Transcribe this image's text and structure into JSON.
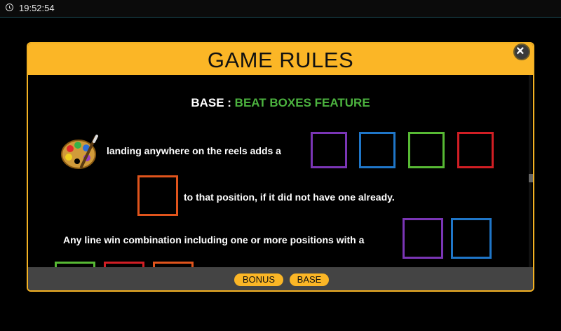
{
  "status_bar": {
    "time": "19:52:54"
  },
  "dialog": {
    "title": "GAME RULES",
    "close_symbol": "×",
    "feature_prefix": "BASE : ",
    "feature_name": "BEAT BOXES FEATURE",
    "line1": "landing anywhere on the reels adds a",
    "line2": "to that position, if it did not have one already.",
    "line3": "Any line win combination including one or more positions with a",
    "box_colors": {
      "purple": "#7a35b5",
      "blue": "#1f76c8",
      "green": "#57b934",
      "red": "#d11e24",
      "orange": "#e0541c"
    },
    "icons": [
      "palette-icon"
    ]
  },
  "footer": {
    "tabs": [
      "BONUS",
      "BASE"
    ]
  },
  "colors": {
    "accent": "#fbb626",
    "feature_green": "#4cb33f"
  }
}
